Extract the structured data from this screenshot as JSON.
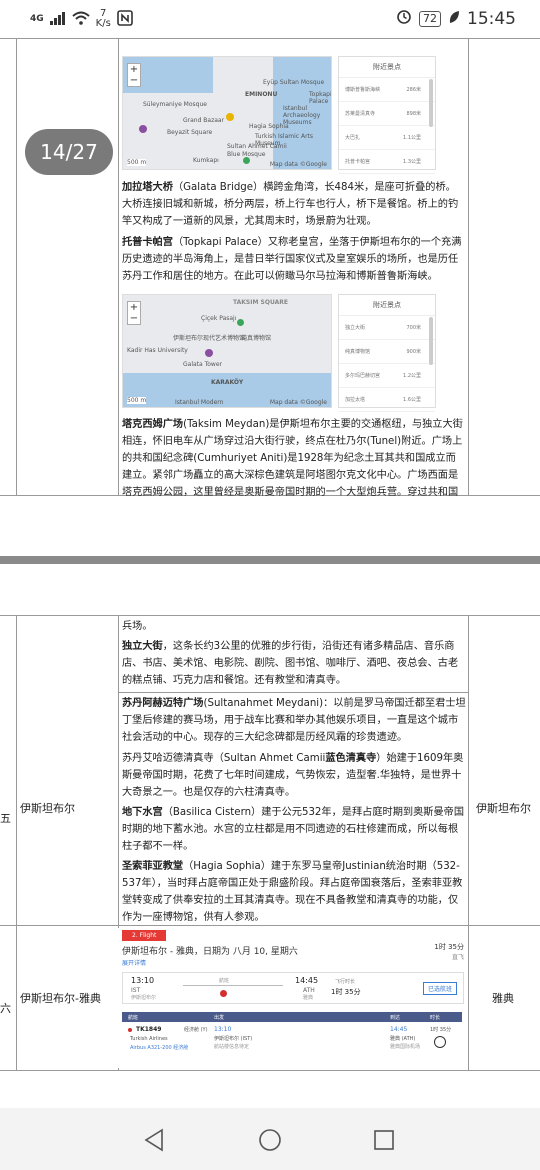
{
  "status_bar": {
    "network": "4G",
    "speed_top": "7",
    "speed_unit": "K/s",
    "battery": "72",
    "time": "15:45"
  },
  "page_badge": "14/27",
  "map1": {
    "labels": [
      "EMINONU",
      "Eyüp Sultan Mosque",
      "Istanbul Archaeology Museums",
      "Topkapi Palace",
      "Hagia Sophia",
      "Turkish Islamic Arts Museum",
      "Sultan Ahmet Camii",
      "Blue Mosque",
      "Grand Bazaar",
      "Beyazit Square",
      "Süleymaniye Mosque",
      "Kumkapı"
    ],
    "scale": "500 m",
    "credit": "Map data ©Google",
    "panel_title": "附近景点",
    "panel_rows": [
      {
        "name": "博斯普鲁斯海峡",
        "dist": "286米"
      },
      {
        "name": "苏莱曼清真寺",
        "dist": "898米"
      },
      {
        "name": "大巴扎",
        "dist": "1.1公里"
      },
      {
        "name": "托普卡帕宫",
        "dist": "1.3公里"
      }
    ]
  },
  "para1": {
    "bold": "加拉塔大桥",
    "text": "（Galata Bridge）横跨金角湾，长484米，是座可折叠的桥。大桥连接旧城和新城，桥分两层，桥上行车也行人，桥下是餐馆。桥上的钓竿又构成了一道新的风景，尤其周末时，场景蔚为壮观。"
  },
  "para2": {
    "bold": "托普卡帕宫",
    "text": "（Topkapi Palace）又称老皇宫，坐落于伊斯坦布尔的一个充满历史遗迹的半岛海角上，是昔日举行国家仪式及皇室娱乐的场所，也是历任苏丹工作和居住的地方。在此可以俯瞰马尔马拉海和博斯普鲁斯海峡。"
  },
  "map2": {
    "labels": [
      "TAKSIM SQUARE",
      "Çiçek Pasajı",
      "伊斯坦布尔现代艺术博物馆",
      "纯真博物馆",
      "Galata Tower",
      "KARAKÖY",
      "Kadir Has University",
      "Istanbul Modern"
    ],
    "scale": "500 m",
    "credit": "Map data ©Google",
    "panel_title": "附近景点",
    "panel_rows": [
      {
        "name": "独立大街",
        "dist": "700米"
      },
      {
        "name": "纯真博物馆",
        "dist": "900米"
      },
      {
        "name": "多尔玛巴赫切宫",
        "dist": "1.2公里"
      },
      {
        "name": "加拉太塔",
        "dist": "1.6公里"
      }
    ]
  },
  "para3": {
    "bold": "塔克西姆广场",
    "text": "(Taksim Meydan)是伊斯坦布尔主要的交通枢纽，与独立大街相连，怀旧电车从广场穿过沿大街行驶，终点在杜乃尔(Tunel)附近。广场上的共和国纪念碑(Cumhuriyet Aniti)是1928年为纪念土耳其共和国成立而建立。紧邻广场矗立的高大深棕色建筑是阿塔图尔克文化中心。广场西面是塔克西姆公园，这里曾经是奥斯曼帝国时期的一个大型炮兵营。穿过共和国大道便到了炮兵营的阅"
  },
  "lower": {
    "para_top": "兵场。",
    "para_indep": {
      "bold": "独立大街",
      "text": "，这条长约3公里的优雅的步行街，沿街还有诸多精品店、音乐商店、书店、美术馆、电影院、剧院、图书馆、咖啡厅、酒吧、夜总会、古老的糕点铺、巧克力店和餐馆。还有教堂和清真寺。"
    },
    "para_sultan": {
      "bold": "苏丹阿赫迈特广场",
      "text": "(Sultanahmet Meydani)：以前是罗马帝国迁都至君士坦丁堡后修建的赛马场，用于战车比赛和举办其他娱乐项目，一直是这个城市社会活动的中心。现存的三大纪念碑都是历经风霜的珍贵遗迹。"
    },
    "para_blue": {
      "text1": "苏丹艾哈迈德清真寺（Sultan Ahmet Camii",
      "bold": "蓝色清真寺",
      "text2": "）始建于1609年奥斯曼帝国时期，花费了七年时间建成，气势恢宏，造型奢.华独特，是世界十大奇景之一。也是仅存的六柱清真寺。"
    },
    "para_cistern": {
      "bold": "地下水宫",
      "text": "（Basilica Cistern）建于公元532年，是拜占庭时期到奥斯曼帝国时期的地下蓄水池。水宫的立柱都是用不同遗迹的石柱修建而成，所以每根柱子都不一样。"
    },
    "para_hagia": {
      "bold": "圣索菲亚教堂",
      "text": "（Hagia Sophia）建于东罗马皇帝Justinian统治时期（532-537年），当时拜占庭帝国正处于鼎盛阶段。拜占庭帝国衰落后，圣索菲亚教堂转变成了供奉安拉的土耳其清真寺。现在不具备教堂和清真寺的功能，仅作为一座博物馆，供有人参观。"
    },
    "row5_day": "五",
    "row5_city": "伊斯坦布尔",
    "row5_right": "伊斯坦布尔",
    "row6_day": "六",
    "row6_city": "伊斯坦布尔-雅典",
    "row6_right": "雅典"
  },
  "flight": {
    "tag": "2. Flight",
    "route": "伊斯坦布尔 - 雅典，日期为 八月 10, 星期六",
    "link": "展开详情",
    "duration_top": "1时 35分",
    "duration_top_sub": "直飞",
    "dep_time": "13:10",
    "dep_code": "IST",
    "dep_sub": "伊斯坦布尔",
    "mid_label": "航班",
    "arr_time": "14:45",
    "arr_code": "ATH",
    "arr_sub": "雅典",
    "nonstop": "飞行时长",
    "duration": "1时 35分",
    "select_btn": "已选航班",
    "head_cols": [
      "航班",
      "出发",
      "",
      "到达",
      "时长"
    ],
    "flight_no": "TK1849",
    "airline": "Turkish Airlines",
    "aircraft": "Airbus A321-200 经济舱",
    "class_label": "经济舱 (Y)",
    "dep_detail_time": "13:10",
    "dep_detail_place": "伊斯坦布尔 (IST)",
    "dep_detail_note": "航站楼信息待定",
    "arr_detail_time": "14:45",
    "arr_detail_place": "雅典 (ATH)",
    "arr_detail_note": "雅典国际机场",
    "detail_duration": "1时 35分"
  }
}
